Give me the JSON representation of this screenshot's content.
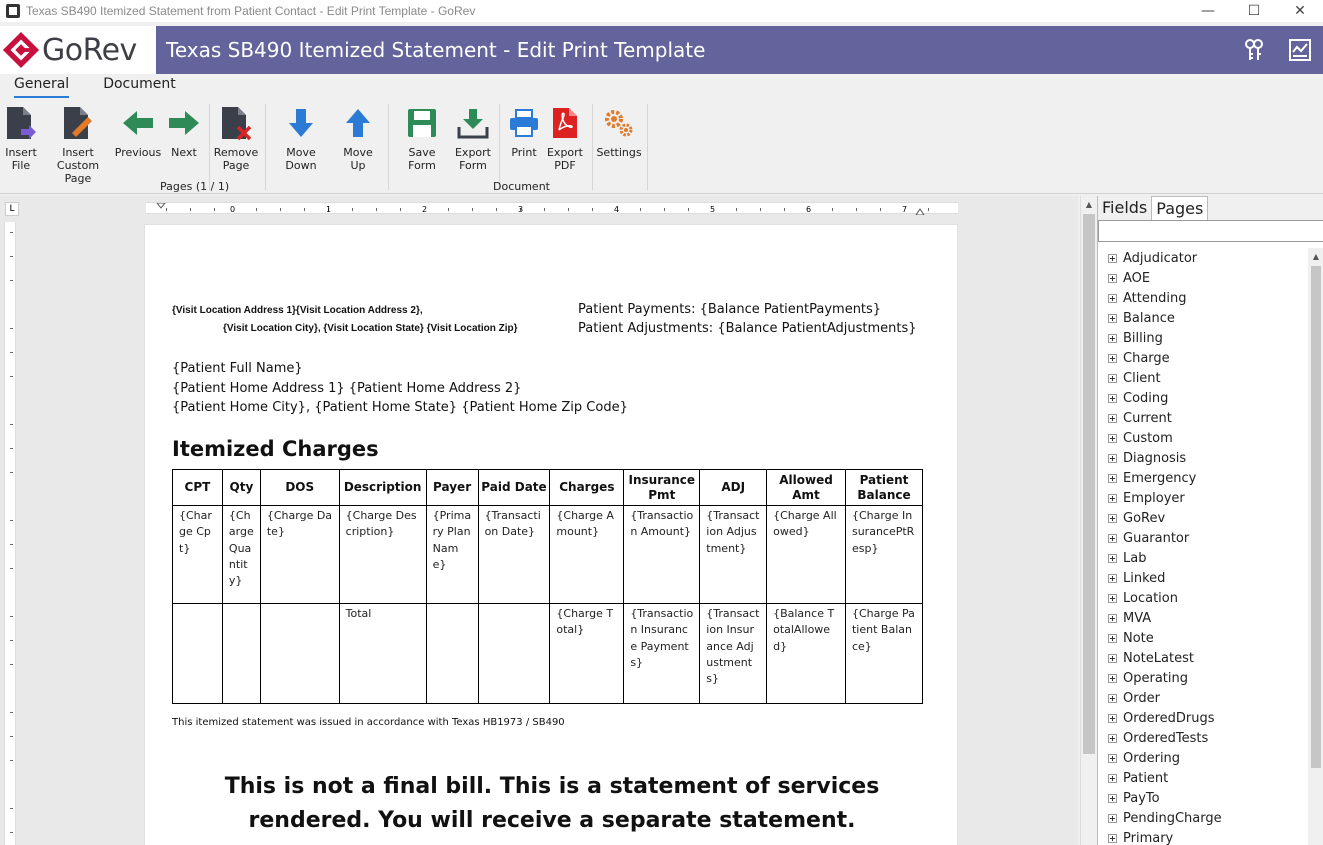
{
  "window": {
    "title": "Texas SB490 Itemized Statement from Patient Contact - Edit Print Template - GoRev"
  },
  "header": {
    "logo_text": "GoRev",
    "title": "Texas SB490 Itemized Statement - Edit Print Template"
  },
  "ribbon": {
    "tabs": [
      {
        "label": "General"
      },
      {
        "label": "Document"
      }
    ],
    "buttons": {
      "insert_file": "Insert\nFile",
      "insert_custom_page": "Insert\nCustom Page",
      "previous": "Previous",
      "next": "Next",
      "remove_page": "Remove\nPage",
      "move_down": "Move Down",
      "move_up": "Move Up",
      "save_form": "Save Form",
      "export_form": "Export\nForm",
      "print": "Print",
      "export_pdf": "Export\nPDF",
      "settings": "Settings"
    },
    "groups": {
      "pages": "Pages (1 / 1)",
      "document": "Document"
    }
  },
  "document": {
    "ruler_marks": [
      "0",
      "1",
      "2",
      "3",
      "4",
      "5",
      "6",
      "7"
    ],
    "visit_address_line1": "{Visit Location Address 1}{Visit Location Address 2},",
    "visit_address_line2": "{Visit Location City}, {Visit Location State} {Visit Location Zip}",
    "patient_payments": "Patient Payments: {Balance PatientPayments}",
    "patient_adjustments": "Patient Adjustments: {Balance PatientAdjustments}",
    "patient_name": "{Patient Full Name}",
    "patient_address": "{Patient Home Address 1} {Patient Home Address 2}",
    "patient_city": "{Patient Home City}, {Patient Home State} {Patient Home Zip Code}",
    "itemized_title": "Itemized Charges",
    "table": {
      "headers": [
        "CPT",
        "Qty",
        "DOS",
        "Description",
        "Payer",
        "Paid Date",
        "Charges",
        "Insurance Pmt",
        "ADJ",
        "Allowed Amt",
        "Patient Balance"
      ],
      "row1": [
        "{Charge Cpt}",
        "{Charge Quantity}",
        "{Charge Date}",
        "{Charge Description}",
        "{Primary Plan Name}",
        "{Transaction Date}",
        "{Charge Amount}",
        "{Transaction Amount}",
        "{Transaction Adjustment}",
        "{Charge Allowed}",
        "{Charge InsurancePtResp}"
      ],
      "row2": [
        "",
        "",
        "",
        "Total",
        "",
        "",
        "{Charge Total}",
        "{Transaction Insurance Payments}",
        "{Transaction Insurance Adjustments}",
        "{Balance TotalAllowed}",
        "{Charge Patient Balance}"
      ]
    },
    "footer_note": "This  itemized statement was issued in accordance with Texas HB1973 / SB490",
    "not_final_line1": "This is not a final bill.  This is a statement of services",
    "not_final_line2": "rendered. You will receive a separate statement."
  },
  "right_panel": {
    "tabs": [
      "Fields",
      "Pages"
    ],
    "active_tab": "Fields",
    "fields": [
      "Adjudicator",
      "AOE",
      "Attending",
      "Balance",
      "Billing",
      "Charge",
      "Client",
      "Coding",
      "Current",
      "Custom",
      "Diagnosis",
      "Emergency",
      "Employer",
      "GoRev",
      "Guarantor",
      "Lab",
      "Linked",
      "Location",
      "MVA",
      "Note",
      "NoteLatest",
      "Operating",
      "Order",
      "OrderedDrugs",
      "OrderedTests",
      "Ordering",
      "Patient",
      "PayTo",
      "PendingCharge",
      "Primary"
    ]
  },
  "colors": {
    "header_bg": "#62649b",
    "logo_red": "#c8103e",
    "accent_blue": "#2b7bd6",
    "green_arrow": "#2e8b57",
    "blue_arrow": "#2b7bd6"
  }
}
